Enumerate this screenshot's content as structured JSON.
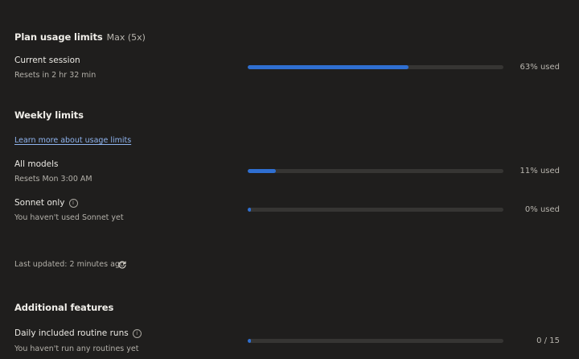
{
  "plan": {
    "title": "Plan usage limits",
    "badge": "Max (5x)"
  },
  "current_session": {
    "label": "Current session",
    "reset": "Resets in 2 hr 32 min",
    "percent": 63,
    "percent_label": "63% used"
  },
  "weekly": {
    "title": "Weekly limits",
    "learn_more": "Learn more about usage limits",
    "all_models": {
      "label": "All models",
      "reset": "Resets Mon 3:00 AM",
      "percent": 11,
      "percent_label": "11% used"
    },
    "sonnet": {
      "label": "Sonnet only",
      "info_icon": "info-icon",
      "sub": "You haven't used Sonnet yet",
      "percent": 0,
      "percent_label": "0% used"
    }
  },
  "last_updated": {
    "text": "Last updated: 2 minutes ago",
    "icon": "refresh-icon"
  },
  "additional": {
    "title": "Additional features",
    "routines": {
      "label": "Daily included routine runs",
      "info_icon": "info-icon",
      "sub": "You haven't run any routines yet",
      "percent": 0,
      "value_label": "0 / 15"
    }
  },
  "colors": {
    "background": "#1f1e1d",
    "bar_fill": "#2f6fd1",
    "bar_track": "#363533",
    "link": "#8fb4ef"
  }
}
